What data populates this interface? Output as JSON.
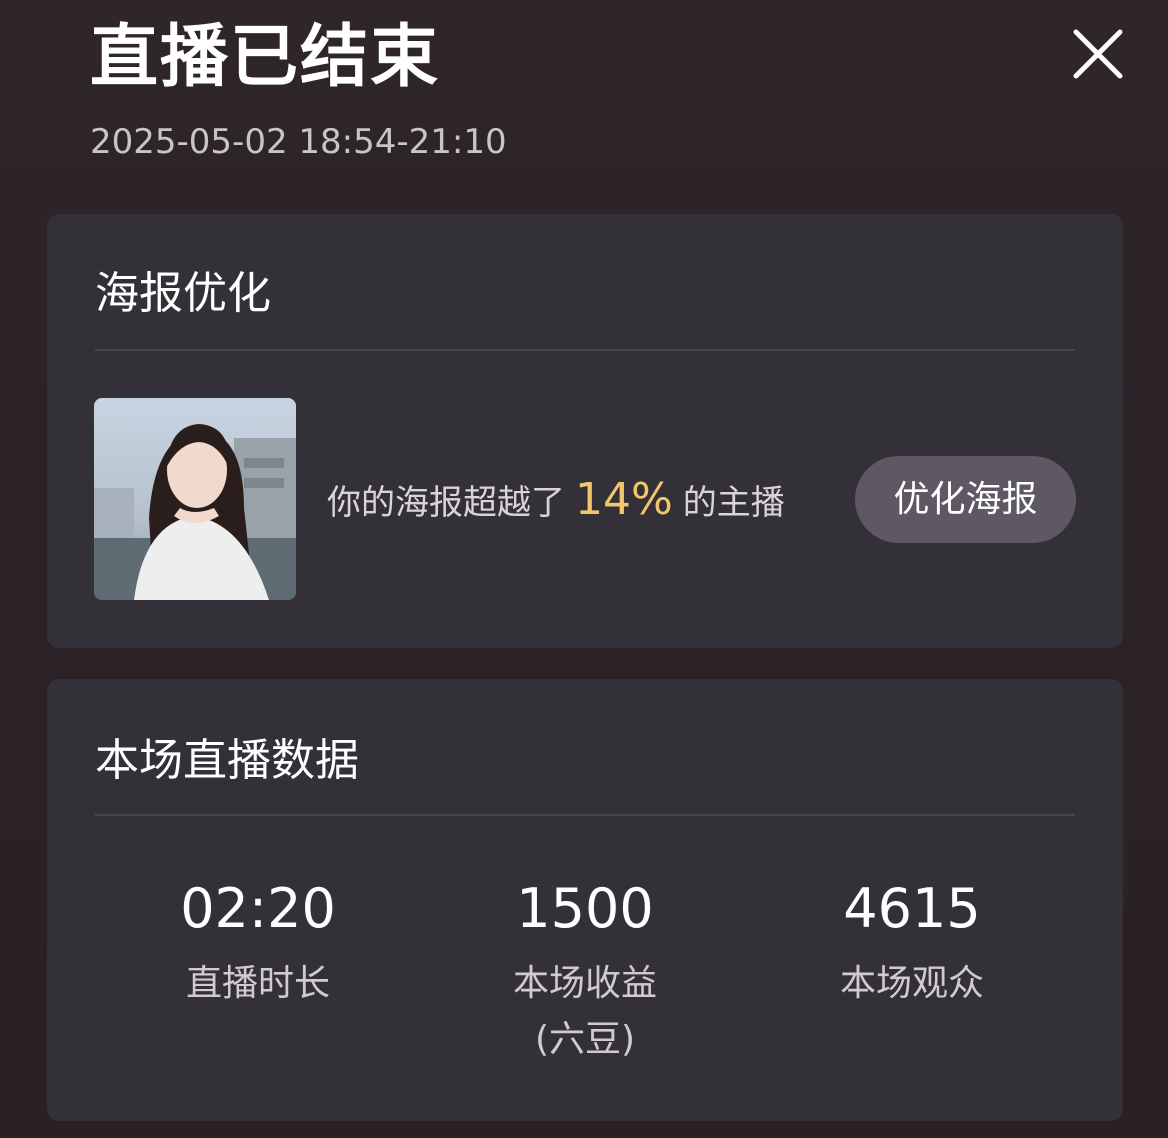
{
  "header": {
    "title": "直播已结束",
    "time_range": "2025-05-02 18:54-21:10",
    "close_icon": "close-icon"
  },
  "poster_card": {
    "title": "海报优化",
    "text_before": "你的海报超越了",
    "percent": "14%",
    "text_after": "的主播",
    "highlight_color": "#f2c66d",
    "button_label": "优化海报"
  },
  "stats_card": {
    "title": "本场直播数据",
    "items": [
      {
        "value": "02:20",
        "label": "直播时长"
      },
      {
        "value": "1500",
        "label": "本场收益",
        "sub_label": "(六豆)"
      },
      {
        "value": "4615",
        "label": "本场观众"
      }
    ]
  }
}
